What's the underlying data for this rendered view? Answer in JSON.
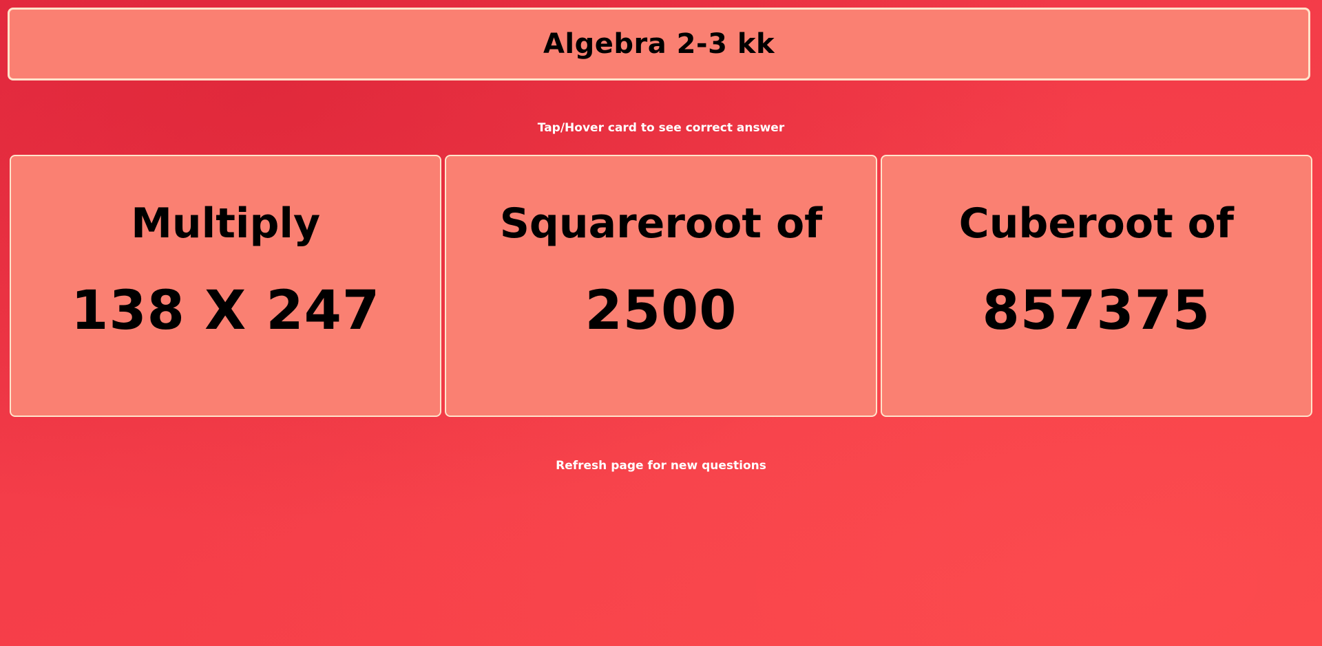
{
  "header": {
    "title": "Algebra 2-3 kk"
  },
  "instructions": {
    "top": "Tap/Hover card to see correct answer",
    "bottom": "Refresh page for new questions"
  },
  "cards": [
    {
      "label": "Multiply",
      "value": "138 X 247"
    },
    {
      "label": "Squareroot of",
      "value": "2500"
    },
    {
      "label": "Cuberoot of",
      "value": "857375"
    }
  ],
  "colors": {
    "background": "#f33a48",
    "card_fill": "#fa8072",
    "card_border": "#ffe4cc",
    "hint_text": "#ffffff"
  }
}
